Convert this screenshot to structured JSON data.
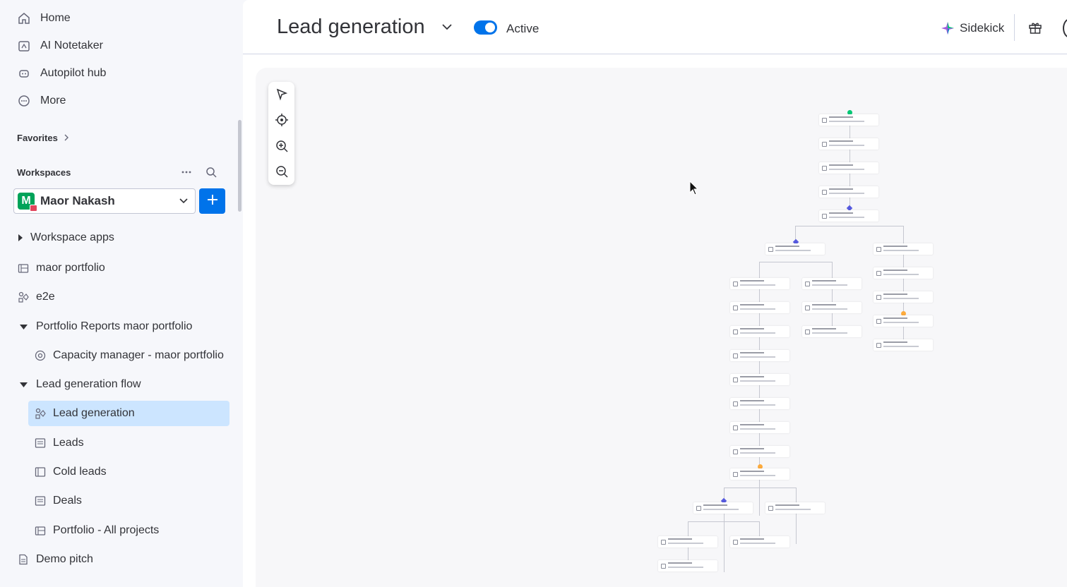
{
  "sidebar": {
    "nav": [
      {
        "label": "Home",
        "icon": "home-icon"
      },
      {
        "label": "AI Notetaker",
        "icon": "notetaker-icon"
      },
      {
        "label": "Autopilot hub",
        "icon": "robot-icon"
      },
      {
        "label": "More",
        "icon": "more-circle-icon"
      }
    ],
    "favorites_label": "Favorites",
    "workspaces_label": "Workspaces",
    "workspace": {
      "initial": "M",
      "name": "Maor Nakash"
    },
    "tree": [
      {
        "label": "Workspace apps",
        "icon": "caret-right-icon"
      },
      {
        "label": "maor portfolio",
        "icon": "portfolio-icon"
      },
      {
        "label": "e2e",
        "icon": "workflow-icon"
      },
      {
        "label": "Portfolio Reports maor portfolio",
        "icon": "caret-down-icon"
      },
      {
        "label": "Capacity manager - maor portfolio",
        "icon": "target-icon"
      },
      {
        "label": "Lead generation flow",
        "icon": "caret-down-icon"
      },
      {
        "label": "Lead generation",
        "icon": "workflow-icon"
      },
      {
        "label": "Leads",
        "icon": "board-icon"
      },
      {
        "label": "Cold leads",
        "icon": "board-icon"
      },
      {
        "label": "Deals",
        "icon": "board-icon"
      },
      {
        "label": "Portfolio - All projects",
        "icon": "portfolio-icon"
      },
      {
        "label": "Demo pitch",
        "icon": "doc-icon"
      }
    ]
  },
  "header": {
    "title": "Lead generation",
    "status_label": "Active",
    "status_active": true,
    "sidekick_label": "Sidekick"
  },
  "colors": {
    "accent": "#0073ea",
    "selected_bg": "#cce5ff",
    "trigger_dot": "#00c875",
    "wait_dot": "#fdab3d",
    "condition": "#5559df"
  }
}
